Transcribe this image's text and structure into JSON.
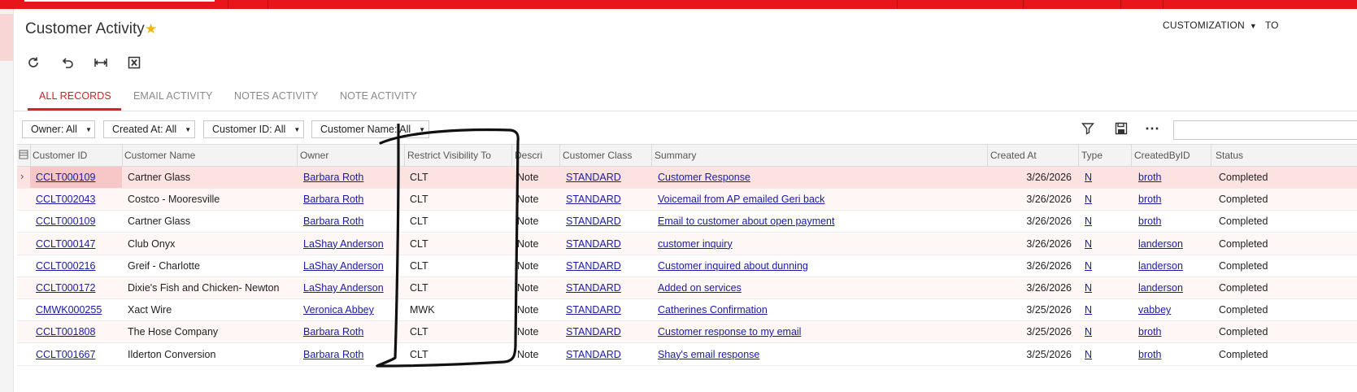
{
  "header": {
    "title": "Customer Activity",
    "customization_label": "CUSTOMIZATION",
    "truncated_menu_label": "TO"
  },
  "toolbar": {
    "icons": [
      "refresh-icon",
      "undo-icon",
      "fit-columns-icon",
      "export-excel-icon"
    ]
  },
  "tabs": [
    {
      "label": "ALL RECORDS",
      "active": true
    },
    {
      "label": "EMAIL ACTIVITY",
      "active": false
    },
    {
      "label": "NOTES ACTIVITY",
      "active": false
    },
    {
      "label": "NOTE ACTIVITY",
      "active": false
    }
  ],
  "filters": [
    {
      "label": "Owner: All"
    },
    {
      "label": "Created At: All"
    },
    {
      "label": "Customer ID: All"
    },
    {
      "label": "Customer Name: All"
    }
  ],
  "grid": {
    "columns": [
      "Customer ID",
      "Customer Name",
      "Owner",
      "Restrict Visibility To",
      "Descri",
      "Customer Class",
      "Summary",
      "Created At",
      "Type",
      "CreatedByID",
      "Status"
    ],
    "rows": [
      [
        "CCLT000109",
        "Cartner Glass",
        "Barbara Roth",
        "CLT",
        "Note",
        "STANDARD",
        "Customer Response",
        "3/26/2026",
        "N",
        "broth",
        "Completed"
      ],
      [
        "CCLT002043",
        "Costco - Mooresville",
        "Barbara Roth",
        "CLT",
        "Note",
        "STANDARD",
        "Voicemail from AP emailed Geri back",
        "3/26/2026",
        "N",
        "broth",
        "Completed"
      ],
      [
        "CCLT000109",
        "Cartner Glass",
        "Barbara Roth",
        "CLT",
        "Note",
        "STANDARD",
        "Email to customer about open payment",
        "3/26/2026",
        "N",
        "broth",
        "Completed"
      ],
      [
        "CCLT000147",
        "Club Onyx",
        "LaShay Anderson",
        "CLT",
        "Note",
        "STANDARD",
        "customer inquiry",
        "3/26/2026",
        "N",
        "landerson",
        "Completed"
      ],
      [
        "CCLT000216",
        "Greif - Charlotte",
        "LaShay Anderson",
        "CLT",
        "Note",
        "STANDARD",
        "Customer inquired about dunning",
        "3/26/2026",
        "N",
        "landerson",
        "Completed"
      ],
      [
        "CCLT000172",
        "Dixie's Fish and Chicken- Newton",
        "LaShay Anderson",
        "CLT",
        "Note",
        "STANDARD",
        "Added on services",
        "3/26/2026",
        "N",
        "landerson",
        "Completed"
      ],
      [
        "CMWK000255",
        "Xact Wire",
        "Veronica Abbey",
        "MWK",
        "Note",
        "STANDARD",
        "Catherines Confirmation",
        "3/25/2026",
        "N",
        "vabbey",
        "Completed"
      ],
      [
        "CCLT001808",
        "The Hose Company",
        "Barbara Roth",
        "CLT",
        "Note",
        "STANDARD",
        "Customer response to my email",
        "3/25/2026",
        "N",
        "broth",
        "Completed"
      ],
      [
        "CCLT001667",
        "Ilderton Conversion",
        "Barbara Roth",
        "CLT",
        "Note",
        "STANDARD",
        "Shay's email response",
        "3/25/2026",
        "N",
        "broth",
        "Completed"
      ]
    ]
  },
  "colors": {
    "brand_red": "#e8161b",
    "active_tab": "#d5212a",
    "link": "#1a1aa6",
    "star": "#f2b705"
  }
}
